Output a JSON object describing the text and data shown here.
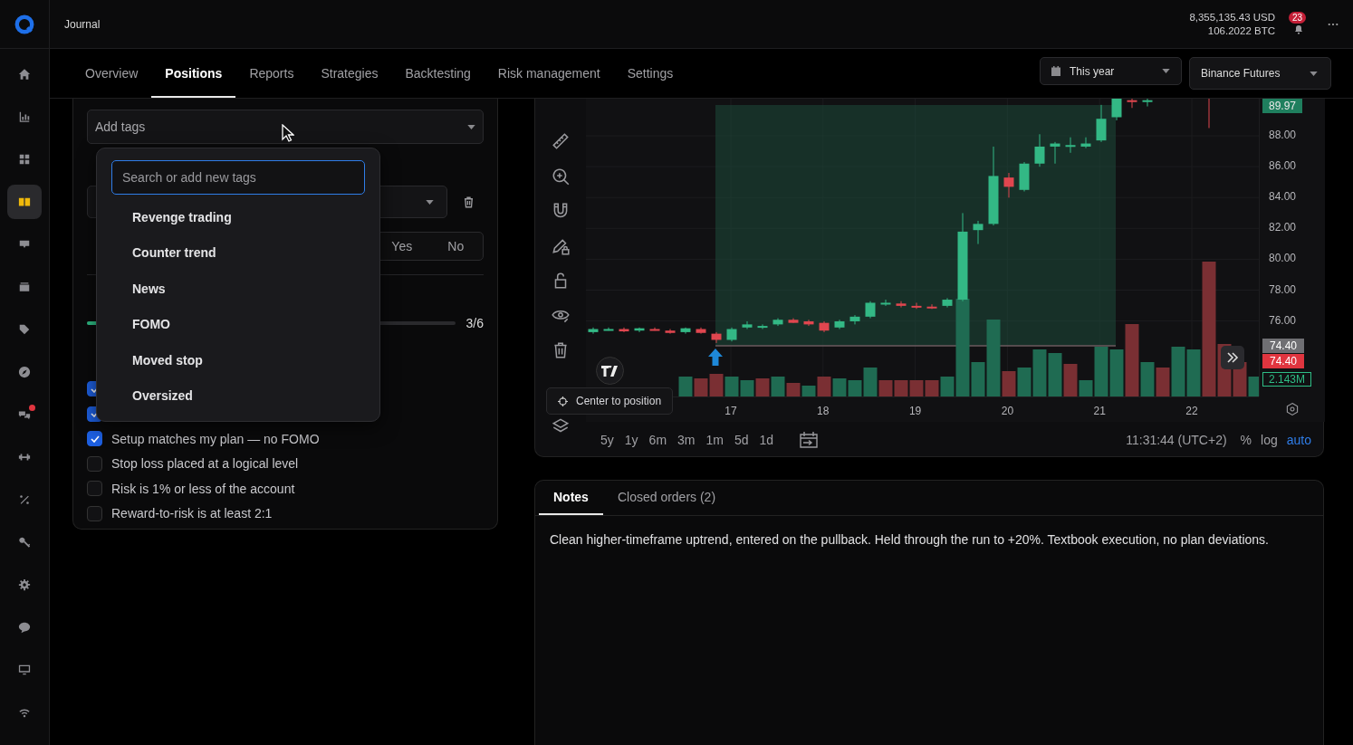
{
  "header": {
    "title": "Journal",
    "balance_usd": "8,355,135.43 USD",
    "balance_btc": "106.2022 BTC",
    "notifications": "23"
  },
  "sidebar": {
    "items": [
      {
        "selected": false,
        "alert": false
      },
      {
        "selected": false,
        "alert": false
      },
      {
        "selected": false,
        "alert": false
      },
      {
        "selected": true,
        "alert": false
      },
      {
        "selected": false,
        "alert": false
      },
      {
        "selected": false,
        "alert": false
      },
      {
        "selected": false,
        "alert": false
      },
      {
        "selected": false,
        "alert": false
      },
      {
        "selected": false,
        "alert": true
      },
      {
        "selected": false,
        "alert": false
      },
      {
        "selected": false,
        "alert": false
      },
      {
        "selected": false,
        "alert": false
      },
      {
        "selected": false,
        "alert": false
      },
      {
        "selected": false,
        "alert": false
      },
      {
        "selected": false,
        "alert": false
      },
      {
        "selected": false,
        "alert": false
      }
    ]
  },
  "tabs": [
    {
      "label": "Overview",
      "selected": false
    },
    {
      "label": "Positions",
      "selected": true
    },
    {
      "label": "Reports",
      "selected": false
    },
    {
      "label": "Strategies",
      "selected": false
    },
    {
      "label": "Backtesting",
      "selected": false
    },
    {
      "label": "Risk management",
      "selected": false
    },
    {
      "label": "Settings",
      "selected": false
    }
  ],
  "filters": [
    {
      "label": "This year",
      "kind": "date"
    },
    {
      "label": "Binance Futures",
      "kind": "select"
    }
  ],
  "tags_field": {
    "placeholder": "Add tags"
  },
  "tag_menu": {
    "search": {
      "placeholder": "Search or add new tags"
    },
    "options": [
      "Revenge trading",
      "Counter trend",
      "News",
      "FOMO",
      "Moved stop",
      "Oversized"
    ]
  },
  "choice": [
    {
      "label": "Yes",
      "selected": false
    },
    {
      "label": "No",
      "selected": false
    }
  ],
  "progress": {
    "level": 0.5,
    "reading": "3/6"
  },
  "checklist": [
    {
      "checked": true
    },
    {
      "checked": true
    },
    {
      "label": "Setup matches my plan — no FOMO",
      "checked": true
    },
    {
      "label": "Stop loss placed at a logical level",
      "checked": false
    },
    {
      "label": "Risk is 1% or less of the account",
      "checked": false
    },
    {
      "label": "Reward-to-risk is at least 2:1",
      "checked": false
    }
  ],
  "chart": {
    "last_price": "89.97",
    "price_labels": [
      "88.00",
      "86.00",
      "84.00",
      "82.00",
      "80.00",
      "78.00",
      "76.00"
    ],
    "price_tags": [
      {
        "text": "74.40",
        "color": "#6f6f73"
      },
      {
        "text": "74.40",
        "color": "#e0353f"
      }
    ],
    "volume": "2.143M",
    "time_labels": [
      "17",
      "18",
      "19",
      "20",
      "21",
      "22"
    ],
    "center_button": "Center to position",
    "ranges": [
      "5y",
      "1y",
      "6m",
      "3m",
      "1m",
      "5d",
      "1d"
    ],
    "clock": "11:31:44 (UTC+2)",
    "scale_options": [
      {
        "label": "%",
        "selected": false
      },
      {
        "label": "log",
        "selected": false
      },
      {
        "label": "auto",
        "selected": true
      }
    ]
  },
  "notes": {
    "tabs": [
      {
        "label": "Notes",
        "selected": true
      },
      {
        "label": "Closed orders (2)",
        "selected": false
      }
    ],
    "text": "Clean higher-timeframe uptrend, entered on the pullback. Held through the run to +20%. Textbook execution, no plan deviations."
  }
}
